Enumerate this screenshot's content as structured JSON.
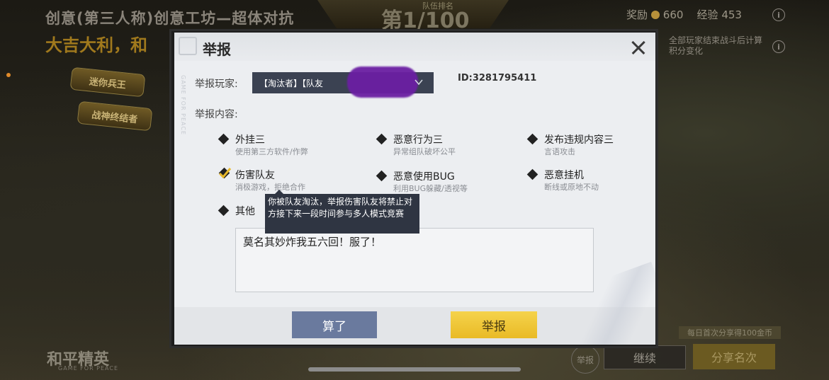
{
  "background": {
    "title": "创意(第三人称)创意工坊—超体对抗",
    "slogan": "大吉大利，和",
    "tag1": "迷你兵王",
    "tag2": "战神终结者",
    "rank_label": "队伍排名",
    "rank": "第1/100",
    "reward_label": "奖励",
    "reward_value": "660",
    "exp_label": "经验",
    "exp_value": "453",
    "info_glyph": "i",
    "notice": "全部玩家结束战斗后计算积分变化",
    "logo": "和平精英",
    "logo_sub": "GAME FOR PEACE",
    "report_circle": "举报",
    "continue": "继续",
    "share_note": "每日首次分享得100金币",
    "share": "分享名次"
  },
  "dialog": {
    "title": "举报",
    "side_text": "GAME FOR PEACE",
    "player_label": "举报玩家:",
    "player_value": "【淘汰者】【队友",
    "player_id": "ID:3281795411",
    "content_label": "举报内容:",
    "options": [
      {
        "title": "外挂三",
        "sub": "使用第三方软件/作弊",
        "checked": false
      },
      {
        "title": "恶意行为三",
        "sub": "异常组队破坏公平",
        "checked": false
      },
      {
        "title": "发布违规内容三",
        "sub": "言语攻击",
        "checked": false
      },
      {
        "title": "伤害队友",
        "sub": "消极游戏，拒绝合作",
        "checked": true
      },
      {
        "title": "恶意使用BUG",
        "sub": "利用BUG躲藏/透视等",
        "checked": false
      },
      {
        "title": "恶意挂机",
        "sub": "断线或原地不动",
        "checked": false
      },
      {
        "title": "其他",
        "sub": "",
        "checked": false
      }
    ],
    "tooltip": "你被队友淘汰，举报伤害队友将禁止对方接下来一段时间参与多人模式竞赛",
    "reason_text": "莫名其妙炸我五六回！服了！",
    "cancel_label": "算了",
    "report_label": "举报"
  },
  "colors": {
    "accent_yellow": "#f0c33a",
    "cancel_blue": "#6a7a9e",
    "select_bg": "#3b4252"
  }
}
